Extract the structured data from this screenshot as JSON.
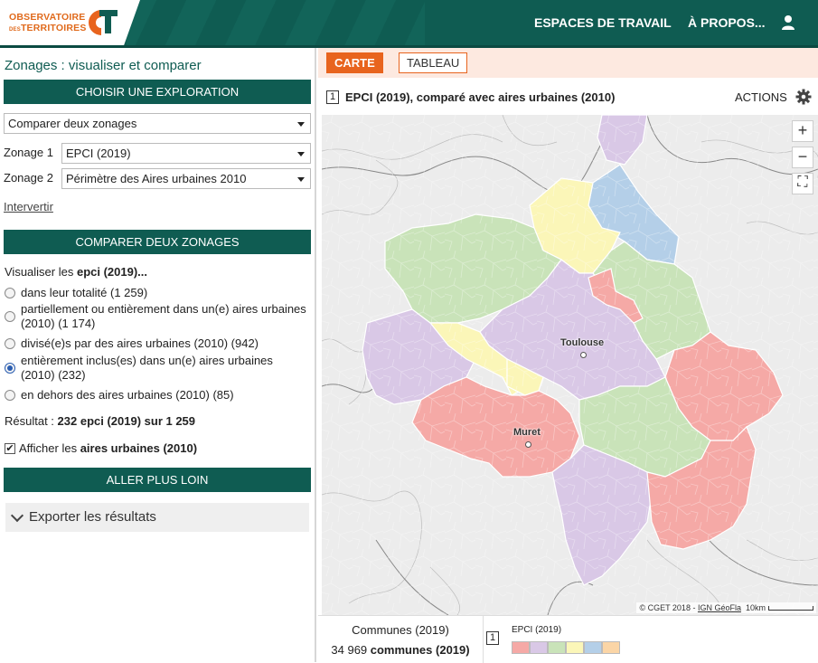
{
  "header": {
    "logo_line1": "OBSERVATOIRE",
    "logo_line2_small": "DES",
    "logo_line3": "TERRITOIRES",
    "nav_workspaces": "ESPACES DE TRAVAIL",
    "nav_about": "À PROPOS...",
    "icons": {
      "user": "user-icon",
      "logo": "ct-logo"
    },
    "colors": {
      "header_bg": "#0f5c52",
      "accent": "#e8641e"
    }
  },
  "left": {
    "page_title": "Zonages : visualiser et comparer",
    "choose_bar": "CHOISIR UNE EXPLORATION",
    "exploration_select": "Comparer deux zonages",
    "zonage1_label": "Zonage 1",
    "zonage1_value": "EPCI (2019)",
    "zonage2_label": "Zonage 2",
    "zonage2_value": "Périmètre des Aires urbaines 2010",
    "swap_link": "Intervertir",
    "compare_bar": "COMPARER DEUX ZONAGES",
    "visualize_prefix": "Visualiser les ",
    "visualize_bold": "epci (2019)...",
    "options": [
      {
        "label": "dans leur totalité (1 259)",
        "selected": false
      },
      {
        "label": "partiellement ou entièrement dans un(e) aires urbaines (2010) (1 174)",
        "selected": false
      },
      {
        "label": "divisé(e)s par des aires urbaines (2010) (942)",
        "selected": false
      },
      {
        "label": "entièrement inclus(es) dans un(e) aires urbaines (2010) (232)",
        "selected": true
      },
      {
        "label": "en dehors des aires urbaines (2010) (85)",
        "selected": false
      }
    ],
    "result_prefix": "Résultat : ",
    "result_bold": "232 epci (2019) sur 1 259",
    "show_checkbox_prefix": "Afficher les ",
    "show_checkbox_bold": "aires urbaines (2010)",
    "show_checkbox_checked": true,
    "further_bar": "ALLER PLUS LOIN",
    "export_label": "Exporter les résultats"
  },
  "right": {
    "tab_map": "CARTE",
    "tab_table": "TABLEAU",
    "map_index": "1",
    "map_title": "EPCI (2019), comparé avec aires urbaines (2010)",
    "actions_label": "ACTIONS",
    "zoom_in": "+",
    "zoom_out": "−",
    "fullscreen": "⛶",
    "cities": {
      "toulouse": "Toulouse",
      "muret": "Muret"
    },
    "attribution_prefix": "© CGET 2018 - ",
    "attribution_link": "IGN GéoFla",
    "scale_label": "10km",
    "communes_label": "Communes (2019)",
    "communes_number": "34 969 ",
    "communes_bold": "communes (2019)",
    "legend_index": "1",
    "legend_title": "EPCI (2019)",
    "legend_colors": [
      "#f5a9a6",
      "#d9c8e6",
      "#c9e3b9",
      "#fbf6b8",
      "#b4cfe8",
      "#fbd5a6"
    ]
  }
}
